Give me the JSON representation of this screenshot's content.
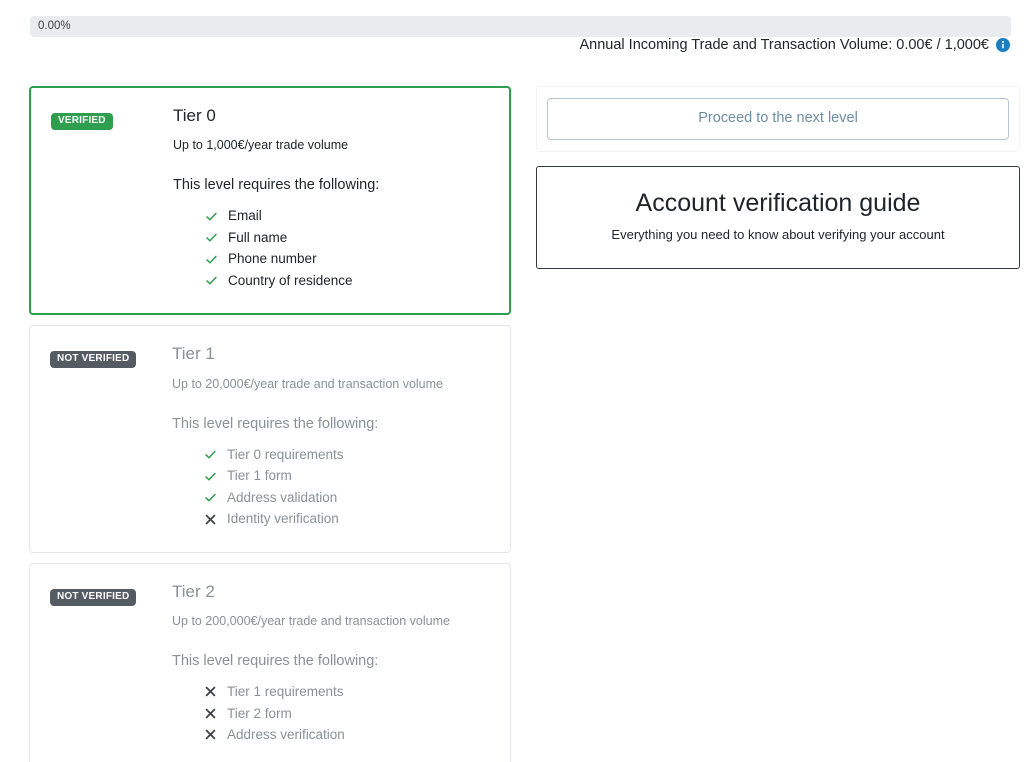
{
  "progress": {
    "label": "0.00%",
    "percent": 0,
    "track_color": "#e9ecef",
    "fill_color": "#2e9e4f"
  },
  "volume": {
    "text": "Annual Incoming Trade and Transaction Volume: 0.00€ / 1,000€",
    "info_icon": "info-circle-icon",
    "info_color": "#1b7ec2"
  },
  "tiers": [
    {
      "badge": "VERIFIED",
      "badge_state": "verified",
      "badge_color": "#2e9e4f",
      "title": "Tier 0",
      "subtitle": "Up to 1,000€/year trade volume",
      "requires_label": "This level requires the following:",
      "requirements": [
        {
          "label": "Email",
          "status": "check"
        },
        {
          "label": "Full name",
          "status": "check"
        },
        {
          "label": "Phone number",
          "status": "check"
        },
        {
          "label": "Country of residence",
          "status": "check"
        }
      ]
    },
    {
      "badge": "NOT VERIFIED",
      "badge_state": "not-verified",
      "badge_color": "#545b62",
      "title": "Tier 1",
      "subtitle": "Up to 20,000€/year trade and transaction volume",
      "requires_label": "This level requires the following:",
      "requirements": [
        {
          "label": "Tier 0 requirements",
          "status": "check"
        },
        {
          "label": "Tier 1 form",
          "status": "check"
        },
        {
          "label": "Address validation",
          "status": "check"
        },
        {
          "label": "Identity verification",
          "status": "cross"
        }
      ]
    },
    {
      "badge": "NOT VERIFIED",
      "badge_state": "not-verified",
      "badge_color": "#545b62",
      "title": "Tier 2",
      "subtitle": "Up to 200,000€/year trade and transaction volume",
      "requires_label": "This level requires the following:",
      "requirements": [
        {
          "label": "Tier 1 requirements",
          "status": "cross"
        },
        {
          "label": "Tier 2 form",
          "status": "cross"
        },
        {
          "label": "Address verification",
          "status": "cross"
        }
      ]
    }
  ],
  "right_panel": {
    "proceed_label": "Proceed to the next level",
    "guide_title": "Account verification guide",
    "guide_subtitle": "Everything you need to know about verifying your account"
  },
  "colors": {
    "check": "#2e9e4f",
    "cross": "#3c4146",
    "accent_green": "#2e9e4f",
    "link_blue": "#6d8da3"
  }
}
